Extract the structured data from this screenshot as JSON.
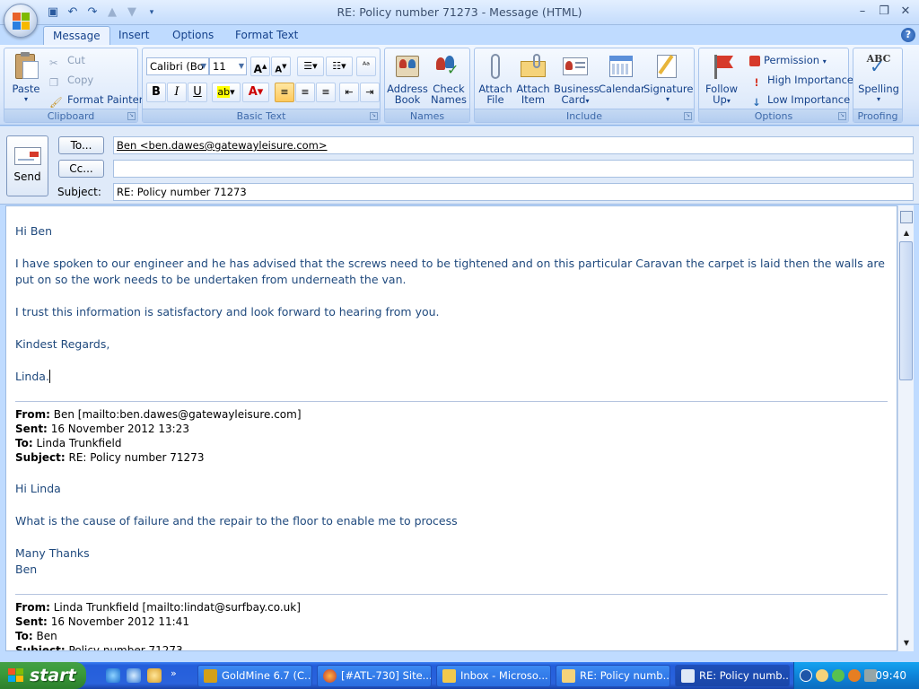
{
  "window": {
    "title": "RE: Policy number 71273 - Message (HTML)",
    "minimize": "–",
    "maximize": "❐",
    "close": "✕"
  },
  "tabs": [
    "Message",
    "Insert",
    "Options",
    "Format Text"
  ],
  "ribbon": {
    "clipboard": {
      "label": "Clipboard",
      "paste": "Paste",
      "cut": "Cut",
      "copy": "Copy",
      "format_painter": "Format Painter"
    },
    "basic_text": {
      "label": "Basic Text",
      "font": "Calibri (Bo",
      "size": "11"
    },
    "names": {
      "label": "Names",
      "address_book": [
        "Address",
        "Book"
      ],
      "check_names": [
        "Check",
        "Names"
      ]
    },
    "include": {
      "label": "Include",
      "attach_file": [
        "Attach",
        "File"
      ],
      "attach_item": [
        "Attach",
        "Item"
      ],
      "business_card": [
        "Business",
        "Card"
      ],
      "calendar": "Calendar",
      "signature": "Signature"
    },
    "options": {
      "label": "Options",
      "follow_up": [
        "Follow",
        "Up"
      ],
      "permission": "Permission",
      "high_importance": "High Importance",
      "low_importance": "Low Importance"
    },
    "proofing": {
      "label": "Proofing",
      "spelling": "Spelling"
    }
  },
  "header": {
    "send": "Send",
    "to_button": "To...",
    "cc_button": "Cc...",
    "subject_label": "Subject:",
    "to_value": "Ben <ben.dawes@gatewayleisure.com>",
    "cc_value": "",
    "subject_value": "RE: Policy number 71273"
  },
  "body": {
    "greeting": "Hi Ben",
    "para1": "I have spoken to our engineer and he has advised that the screws need to be tightened and on this particular Caravan the carpet is laid then the walls are put on so the work needs to be undertaken from underneath the van.",
    "para2": "I trust this information is satisfactory and look forward to hearing from you.",
    "closing": "Kindest Regards,",
    "signature": "Linda.",
    "quote1": {
      "from_label": "From:",
      "from": "Ben [mailto:ben.dawes@gatewayleisure.com]",
      "sent_label": "Sent:",
      "sent": "16 November 2012 13:23",
      "to_label": "To:",
      "to": "Linda Trunkfield",
      "subject_label": "Subject:",
      "subject": "RE: Policy number 71273",
      "greeting": "Hi Linda",
      "text": "What is the cause of failure and the repair to the floor to enable me to process",
      "closing": "Many Thanks",
      "signature": "Ben"
    },
    "quote2": {
      "from_label": "From:",
      "from": "Linda Trunkfield [mailto:lindat@surfbay.co.uk]",
      "sent_label": "Sent:",
      "sent": "16 November 2012 11:41",
      "to_label": "To:",
      "to": "Ben",
      "subject_label": "Subject:",
      "subject": "Policy number 71273"
    }
  },
  "taskbar": {
    "start": "start",
    "items": [
      "GoldMine 6.7 (C...",
      "[#ATL-730] Site...",
      "Inbox - Microso...",
      "RE: Policy numb...",
      "RE: Policy numb..."
    ],
    "clock": "09:40"
  }
}
